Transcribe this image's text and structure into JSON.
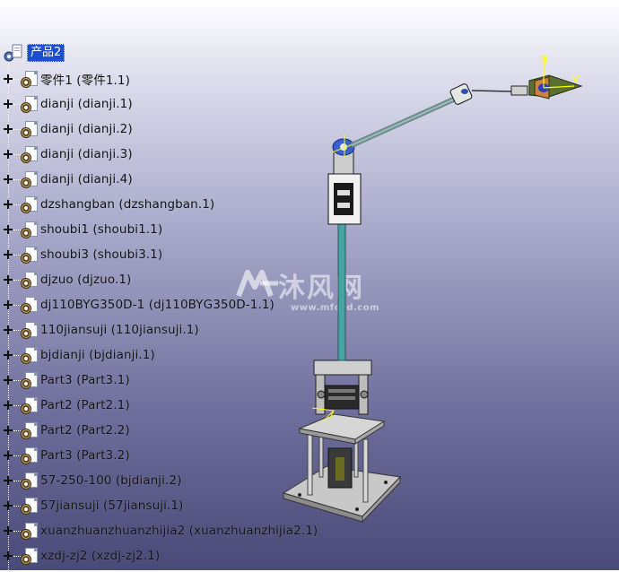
{
  "tree": {
    "root": {
      "label": "产品2",
      "icon": "product-icon"
    },
    "items": [
      {
        "label": "零件1 (零件1.1)"
      },
      {
        "label": "dianji (dianji.1)"
      },
      {
        "label": "dianji (dianji.2)"
      },
      {
        "label": "dianji (dianji.3)"
      },
      {
        "label": "dianji (dianji.4)"
      },
      {
        "label": "dzshangban (dzshangban.1)"
      },
      {
        "label": "shoubi1 (shoubi1.1)"
      },
      {
        "label": "shoubi3 (shoubi3.1)"
      },
      {
        "label": "djzuo (djzuo.1)"
      },
      {
        "label": "dj110BYG350D-1 (dj110BYG350D-1.1)"
      },
      {
        "label": "110jiansuji (110jiansuji.1)"
      },
      {
        "label": "bjdianji (bjdianji.1)"
      },
      {
        "label": "Part3 (Part3.1)"
      },
      {
        "label": "Part2 (Part2.1)"
      },
      {
        "label": "Part2 (Part2.2)"
      },
      {
        "label": "Part3 (Part3.2)"
      },
      {
        "label": "57-250-100 (bjdianji.2)"
      },
      {
        "label": "57jiansuji (57jiansuji.1)"
      },
      {
        "label": "xuanzhuanzhuanzhijia2 (xuanzhuanzhijia2.1)"
      },
      {
        "label": "xzdj-zj2 (xzdj-zj2.1)"
      }
    ]
  },
  "axis_labels": {
    "h": "H",
    "v": "V"
  },
  "watermark": {
    "title": "沐风网",
    "url": "www.mfcad.com"
  },
  "colors": {
    "selection": "#1c4fd0",
    "background_top": "#ffffff",
    "background_bottom": "#4a4a78"
  }
}
